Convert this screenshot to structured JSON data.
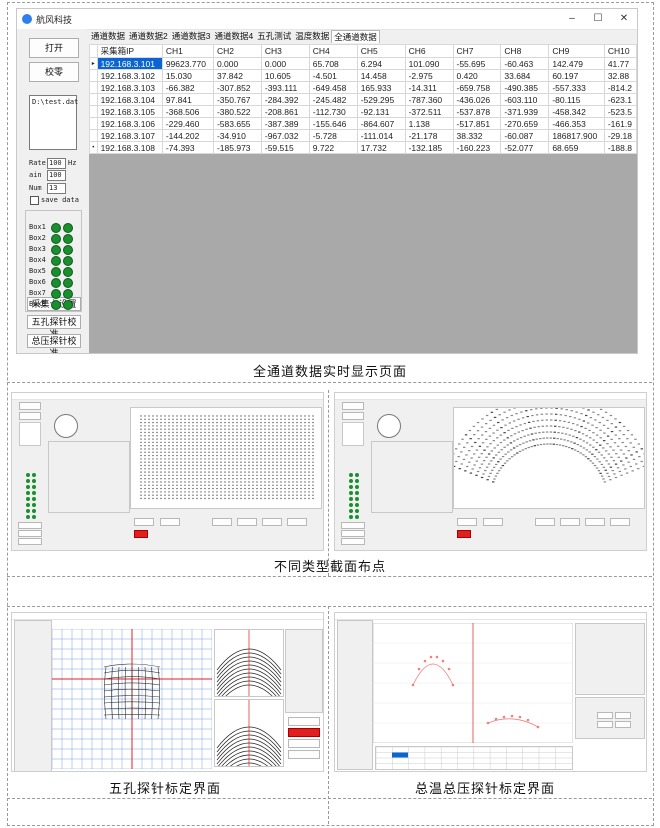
{
  "window": {
    "title": "航风科技",
    "controls": {
      "minimize": "–",
      "maximize": "☐",
      "close": "✕"
    }
  },
  "left_panel": {
    "open_button": "打开",
    "calibrate_button": "校零",
    "file_text": "D:\\test.dat",
    "rate_label": "Rate",
    "rate_value": "100",
    "rate_unit": "Hz",
    "ain_label": "ain",
    "ain_value": "100",
    "num_label": "Num",
    "num_value": "13",
    "save_label": "save data",
    "box_labels": [
      "Box1",
      "Box2",
      "Box3",
      "Box4",
      "Box5",
      "Box6",
      "Box7",
      "Box8"
    ],
    "btn_card_settings": "采集卡设置",
    "btn_five_hole": "五孔探针校准",
    "btn_total_pressure": "总压探针校准"
  },
  "tabs": [
    {
      "label": "通道数据",
      "active": false
    },
    {
      "label": "通道数据2",
      "active": false
    },
    {
      "label": "通道数据3",
      "active": false
    },
    {
      "label": "通道数据4",
      "active": false
    },
    {
      "label": "五孔测试",
      "active": false
    },
    {
      "label": "温度数据",
      "active": false
    },
    {
      "label": "全通道数据",
      "active": true
    }
  ],
  "table": {
    "columns": [
      "采集箱IP",
      "CH1",
      "CH2",
      "CH3",
      "CH4",
      "CH5",
      "CH6",
      "CH7",
      "CH8",
      "CH9",
      "CH10"
    ],
    "rows": [
      {
        "marker": "▸",
        "cells": [
          "192.168.3.101",
          "99623.770",
          "0.000",
          "0.000",
          "65.708",
          "6.294",
          "101.090",
          "-55.695",
          "-60.463",
          "142.479",
          "41.77"
        ]
      },
      {
        "marker": "",
        "cells": [
          "192.168.3.102",
          "15.030",
          "37.842",
          "10.605",
          "-4.501",
          "14.458",
          "-2.975",
          "0.420",
          "33.684",
          "60.197",
          "32.88"
        ]
      },
      {
        "marker": "",
        "cells": [
          "192.168.3.103",
          "-66.382",
          "-307.852",
          "-393.111",
          "-649.458",
          "165.933",
          "-14.311",
          "-659.758",
          "-490.385",
          "-557.333",
          "-814.2"
        ]
      },
      {
        "marker": "",
        "cells": [
          "192.168.3.104",
          "97.841",
          "-350.767",
          "-284.392",
          "-245.482",
          "-529.295",
          "-787.360",
          "-436.026",
          "-603.110",
          "-80.115",
          "-623.1"
        ]
      },
      {
        "marker": "",
        "cells": [
          "192.168.3.105",
          "-368.506",
          "-380.522",
          "-208.861",
          "-112.730",
          "-92.131",
          "-372.511",
          "-537.878",
          "-371.939",
          "-458.342",
          "-523.5"
        ]
      },
      {
        "marker": "",
        "cells": [
          "192.168.3.106",
          "-229.460",
          "-583.655",
          "-387.389",
          "-155.646",
          "-864.607",
          "1.138",
          "-517.851",
          "-270.659",
          "-466.353",
          "-161.9"
        ]
      },
      {
        "marker": "",
        "cells": [
          "192.168.3.107",
          "-144.202",
          "-34.910",
          "-967.032",
          "-5.728",
          "-111.014",
          "-21.178",
          "38.332",
          "-60.087",
          "186817.900",
          "-29.18"
        ]
      },
      {
        "marker": "•",
        "cells": [
          "192.168.3.108",
          "-74.393",
          "-185.973",
          "-59.515",
          "9.722",
          "17.732",
          "-132.185",
          "-160.223",
          "-52.077",
          "68.659",
          "-188.8"
        ]
      }
    ]
  },
  "captions": {
    "main": "全通道数据实时显示页面",
    "layouts": "不同类型截面布点",
    "five_hole": "五孔探针标定界面",
    "total_temp_pressure": "总温总压探针标定界面"
  }
}
